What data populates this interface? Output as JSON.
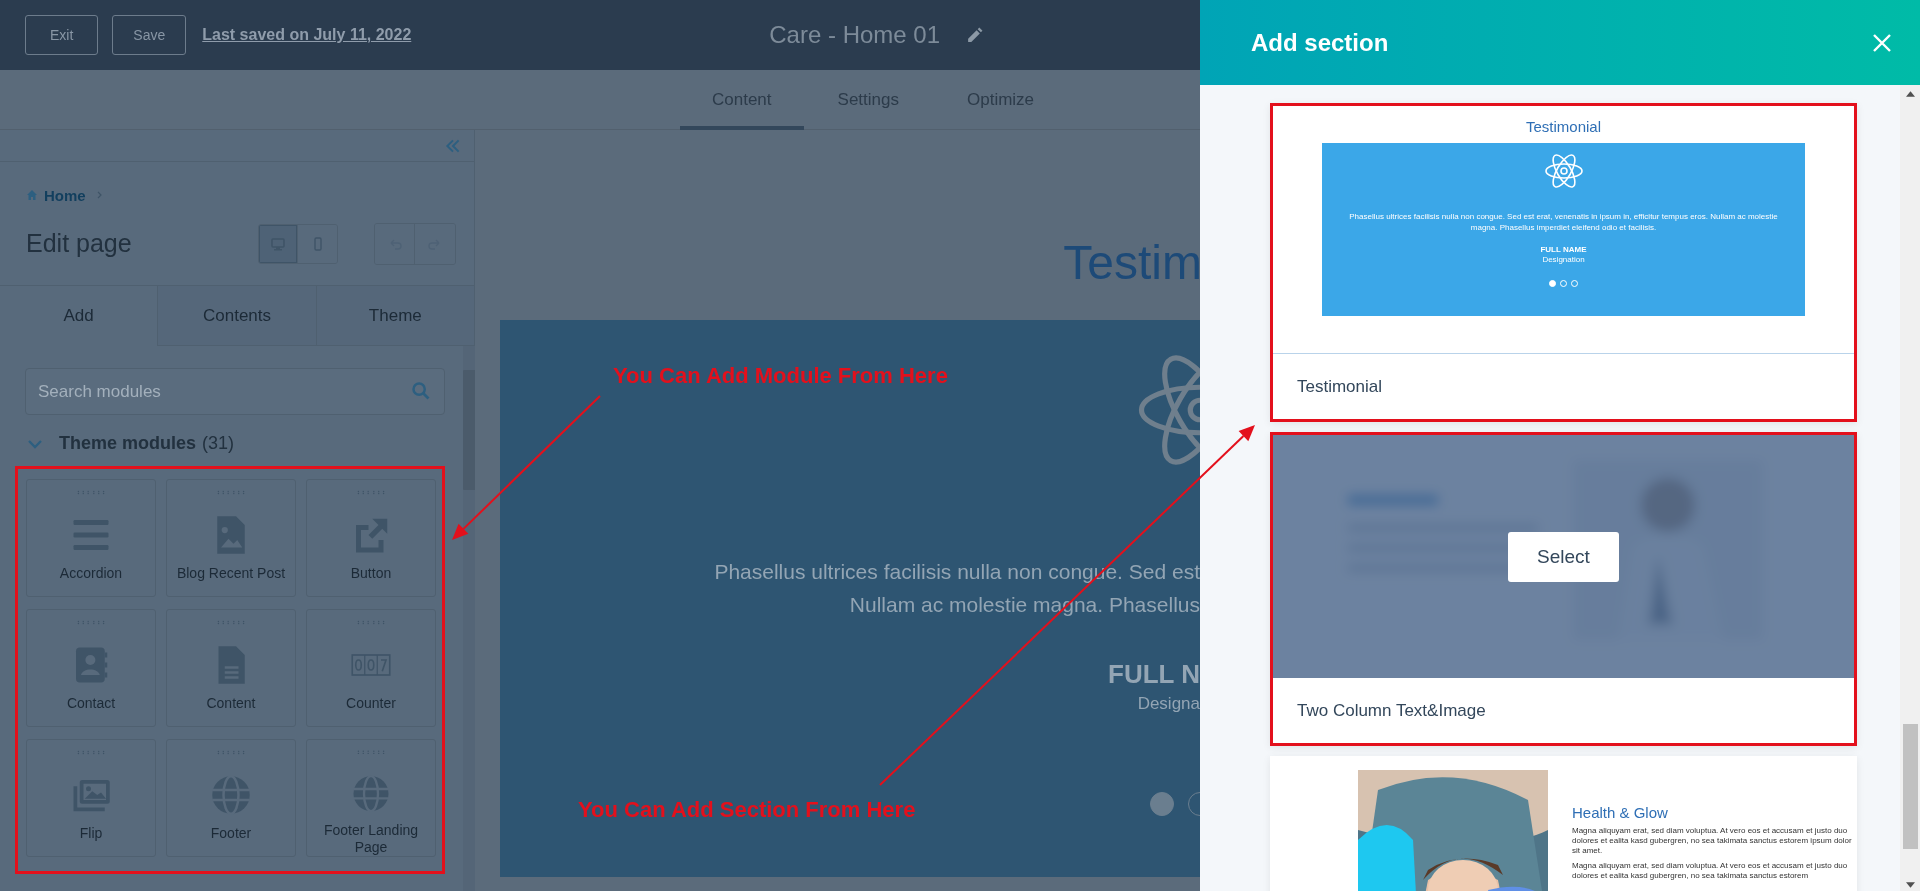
{
  "header": {
    "buttons": [
      "Exit",
      "Save"
    ],
    "last_saved": "Last saved on July 11, 2022",
    "page_title": "Care - Home 01"
  },
  "editor_tabs": [
    {
      "label": "Content",
      "selected": true
    },
    {
      "label": "Settings",
      "selected": false
    },
    {
      "label": "Optimize",
      "selected": false
    }
  ],
  "sidebar": {
    "breadcrumb": "Home",
    "title": "Edit page",
    "view_modes": [
      {
        "kind": "desktop",
        "selected": true
      },
      {
        "kind": "mobile",
        "selected": false
      }
    ],
    "history": [
      {
        "kind": "undo",
        "disabled": true
      },
      {
        "kind": "redo",
        "disabled": true
      }
    ],
    "tabs": [
      {
        "label": "Add",
        "selected": true
      },
      {
        "label": "Contents",
        "selected": false
      },
      {
        "label": "Theme",
        "selected": false
      }
    ],
    "search": {
      "placeholder": "Search modules"
    },
    "group": {
      "title": "Theme modules",
      "count": "(31)",
      "expanded": true,
      "highlighted": true
    },
    "modules": [
      {
        "label": "Accordion",
        "kind": "lines"
      },
      {
        "label": "Blog Recent Post",
        "kind": "image-file"
      },
      {
        "label": "Button",
        "kind": "external"
      },
      {
        "label": "Contact",
        "kind": "contact"
      },
      {
        "label": "Content",
        "kind": "document"
      },
      {
        "label": "Counter",
        "kind": "counter"
      },
      {
        "label": "Flip",
        "kind": "gallery"
      },
      {
        "label": "Footer",
        "kind": "globe"
      },
      {
        "label": "Footer Landing Page",
        "kind": "globe"
      }
    ]
  },
  "canvas": {
    "heading": "Testim",
    "quote_lines": [
      "Phasellus ultrices facilisis nulla non congue. Sed est",
      "Nullam ac molestie magna. Phasellus"
    ],
    "name": "FULL N",
    "role": "Designa",
    "dots": [
      {
        "selected": true
      },
      {
        "selected": false
      }
    ]
  },
  "add_section": {
    "title": "Add section",
    "sections": [
      {
        "kind": "testimonial",
        "label": "Testimonial",
        "highlighted": true,
        "hovered": false,
        "heading": "Testimonial",
        "quote": "Phasellus ultrices facilisis nulla non congue. Sed est erat, venenatis in ipsum in, efficitur tempus eros. Nullam ac molestie magna. Phasellus imperdiet eleifend odio et facilisis.",
        "name": "FULL NAME",
        "role": "Designation",
        "dots": [
          {
            "selected": true
          },
          {
            "selected": false
          },
          {
            "selected": false
          }
        ]
      },
      {
        "kind": "two-column",
        "label": "Two Column Text&Image",
        "highlighted": true,
        "hovered": true,
        "action": "Select"
      },
      {
        "kind": "feature",
        "highlighted": false,
        "hovered": false,
        "heading": "Health & Glow",
        "paragraphs": [
          "Magna aliquyam erat, sed diam voluptua. At vero eos et accusam et justo duo dolores et ealita kasd gubergren, no sea takimata sanctus estorem ipsum dolor sit amet.",
          "Magna aliquyam erat, sed diam voluptua. At vero eos et accusam et justo duo dolores et ealita kasd gubergren, no sea takimata sanctus estorem"
        ]
      }
    ]
  },
  "annotations": [
    {
      "text": "You Can Add Module From Here"
    },
    {
      "text": "You Can Add Section From Here"
    }
  ]
}
